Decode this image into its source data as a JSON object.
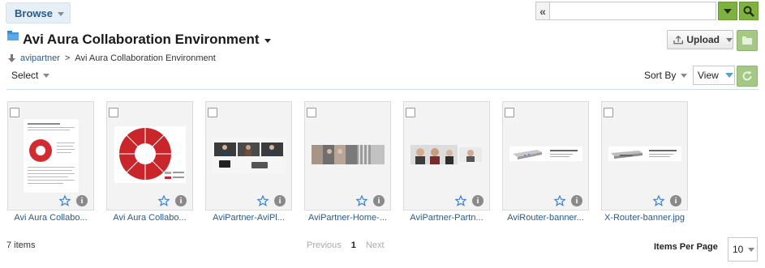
{
  "header": {
    "browse_label": "Browse",
    "search": {
      "value": "",
      "placeholder": ""
    }
  },
  "title": {
    "text": "Avi Aura Collaboration Environment",
    "folder_icon": "folder-icon",
    "upload_label": "Upload"
  },
  "breadcrumb": {
    "parent": "avipartner",
    "separator": ">",
    "current": "Avi Aura Collaboration Environment"
  },
  "toolbar": {
    "select_label": "Select",
    "sort_by_label": "Sort By",
    "view_label": "View"
  },
  "items": [
    {
      "name": "Avi Aura Collabo...",
      "thumb": "document-page"
    },
    {
      "name": "Avi Aura Collabo...",
      "thumb": "circle-diagram"
    },
    {
      "name": "AviPartner-AviPl...",
      "thumb": "video-conference"
    },
    {
      "name": "AviPartner-Home-...",
      "thumb": "people-banner"
    },
    {
      "name": "AviPartner-Partn...",
      "thumb": "people-banner-2"
    },
    {
      "name": "AviRouter-banner...",
      "thumb": "router-banner"
    },
    {
      "name": "X-Router-banner.jpg",
      "thumb": "router-banner-2"
    }
  ],
  "footer": {
    "count": "7 items",
    "previous": "Previous",
    "current_page": "1",
    "next": "Next",
    "items_per_page_label": "Items Per Page",
    "items_per_page_value": "10"
  },
  "colors": {
    "accent_green": "#7fb141",
    "link_blue": "#2a5a8a",
    "star_blue": "#3a7fcf"
  }
}
